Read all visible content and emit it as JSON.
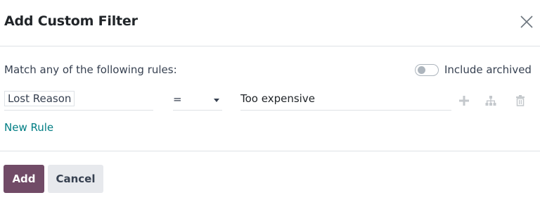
{
  "dialog": {
    "title": "Add Custom Filter"
  },
  "rules_header": {
    "match_text": "Match any of the following rules:",
    "include_archived_label": "Include archived",
    "include_archived_on": false
  },
  "rules": [
    {
      "field": "Lost Reason",
      "operator": "=",
      "value": "Too expensive"
    }
  ],
  "new_rule_label": "New Rule",
  "footer": {
    "add_label": "Add",
    "cancel_label": "Cancel"
  },
  "colors": {
    "primary": "#714b67",
    "link": "#017e84",
    "secondary_button": "#e7e9ed",
    "border": "#dee2e6",
    "muted_icon": "#c4c8cc"
  },
  "icons": {
    "close": "close-icon",
    "add_rule": "plus-icon",
    "branch": "sitemap-icon",
    "delete": "trash-icon"
  }
}
